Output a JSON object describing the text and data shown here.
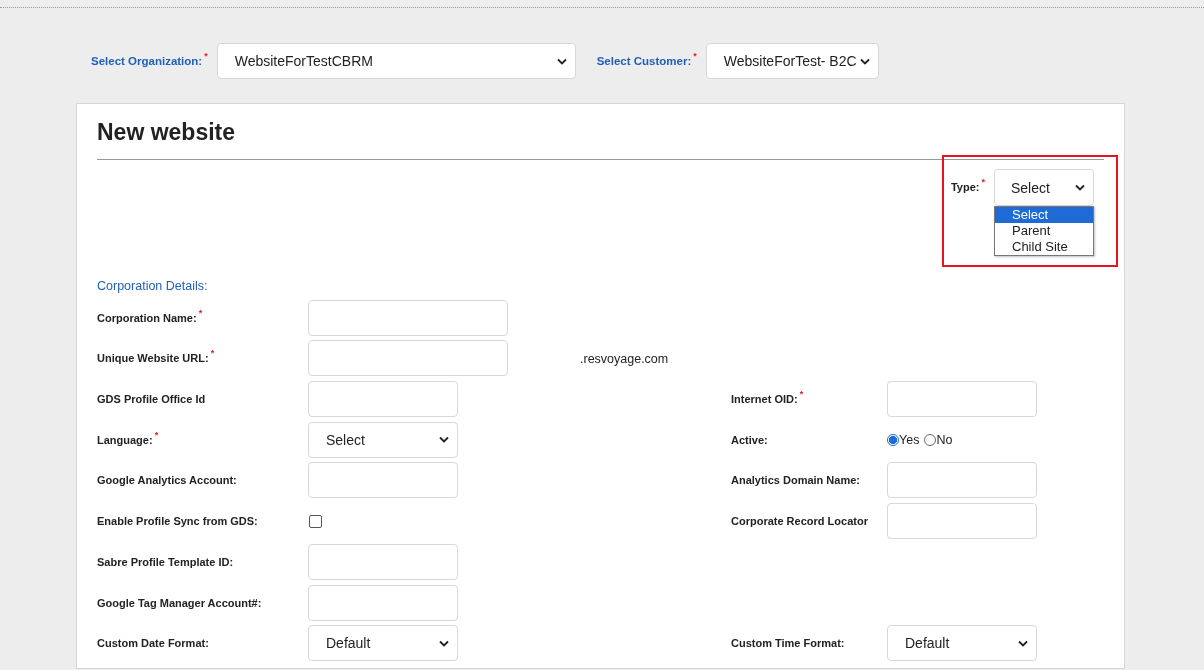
{
  "header": {
    "organization": {
      "label": "Select Organization:",
      "marker": "*",
      "value": "WebsiteForTestCBRM"
    },
    "customer": {
      "label": "Select Customer:",
      "marker": "*",
      "value": "WebsiteForTest- B2C"
    }
  },
  "form": {
    "title": "New website",
    "type_field": {
      "label": "Type:",
      "marker": "*",
      "value": "Select",
      "expanded": true,
      "highlighted": true,
      "options": [
        {
          "label": "Select",
          "selected": true
        },
        {
          "label": "Parent",
          "selected": false
        },
        {
          "label": "Child Site",
          "selected": false
        }
      ]
    },
    "section_title": "Corporation Details:",
    "rows": [
      {
        "left": {
          "kind": "wide_text",
          "label": "Corporation Name:",
          "marker": "*"
        }
      },
      {
        "left": {
          "kind": "wide_text",
          "label": "Unique Website URL:",
          "marker": "*",
          "suffix": ".resvoyage.com"
        }
      },
      {
        "left": {
          "kind": "text",
          "label": "GDS Profile Office Id"
        },
        "right": {
          "kind": "text",
          "label": "Internet OID:",
          "marker": "*"
        }
      },
      {
        "left": {
          "kind": "select",
          "label": "Language:",
          "marker": "*",
          "value": "Select"
        },
        "right": {
          "kind": "radio",
          "label": "Active:",
          "options": [
            {
              "label": "Yes",
              "selected": true
            },
            {
              "label": "No",
              "selected": false
            }
          ]
        }
      },
      {
        "left": {
          "kind": "text",
          "label": "Google Analytics Account:"
        },
        "right": {
          "kind": "text",
          "label": "Analytics Domain Name:"
        }
      },
      {
        "left": {
          "kind": "checkbox",
          "label": "Enable Profile Sync from GDS:",
          "checked": false
        },
        "right": {
          "kind": "text",
          "label": "Corporate Record Locator"
        }
      },
      {
        "left": {
          "kind": "text",
          "label": "Sabre Profile Template ID:"
        }
      },
      {
        "left": {
          "kind": "text",
          "label": "Google Tag Manager Account#:"
        }
      },
      {
        "left": {
          "kind": "select",
          "label": "Custom Date Format:",
          "value": "Default"
        },
        "right": {
          "kind": "select",
          "label": "Custom Time Format:",
          "value": "Default"
        }
      }
    ]
  }
}
